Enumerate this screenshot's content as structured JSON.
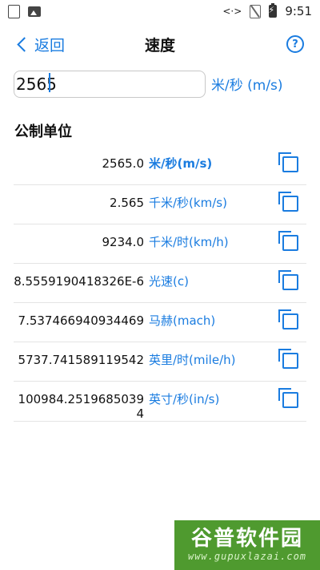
{
  "status_bar": {
    "time": "9:51"
  },
  "app_bar": {
    "back_label": "返回",
    "title": "速度",
    "help_icon": "?"
  },
  "input": {
    "value": "2565",
    "unit": "米/秒 (m/s)"
  },
  "section_title": "公制单位",
  "conversions": [
    {
      "value": "2565.0",
      "unit": "米/秒(m/s)"
    },
    {
      "value": "2.565",
      "unit": "千米/秒(km/s)"
    },
    {
      "value": "9234.0",
      "unit": "千米/时(km/h)"
    },
    {
      "value": "8.5559190418326E-6",
      "unit": "光速(c)"
    },
    {
      "value": "7.537466940934469",
      "unit": "马赫(mach)"
    },
    {
      "value": "5737.741589119542",
      "unit": "英里/时(mile/h)"
    },
    {
      "value": "100984.25196850394",
      "unit": "英寸/秒(in/s)"
    }
  ],
  "watermark": {
    "name": "谷普软件园",
    "url": "www.gupuxlazai.com"
  },
  "colors": {
    "accent": "#1a7ce0",
    "watermark_bg": "#4f9a2f"
  }
}
